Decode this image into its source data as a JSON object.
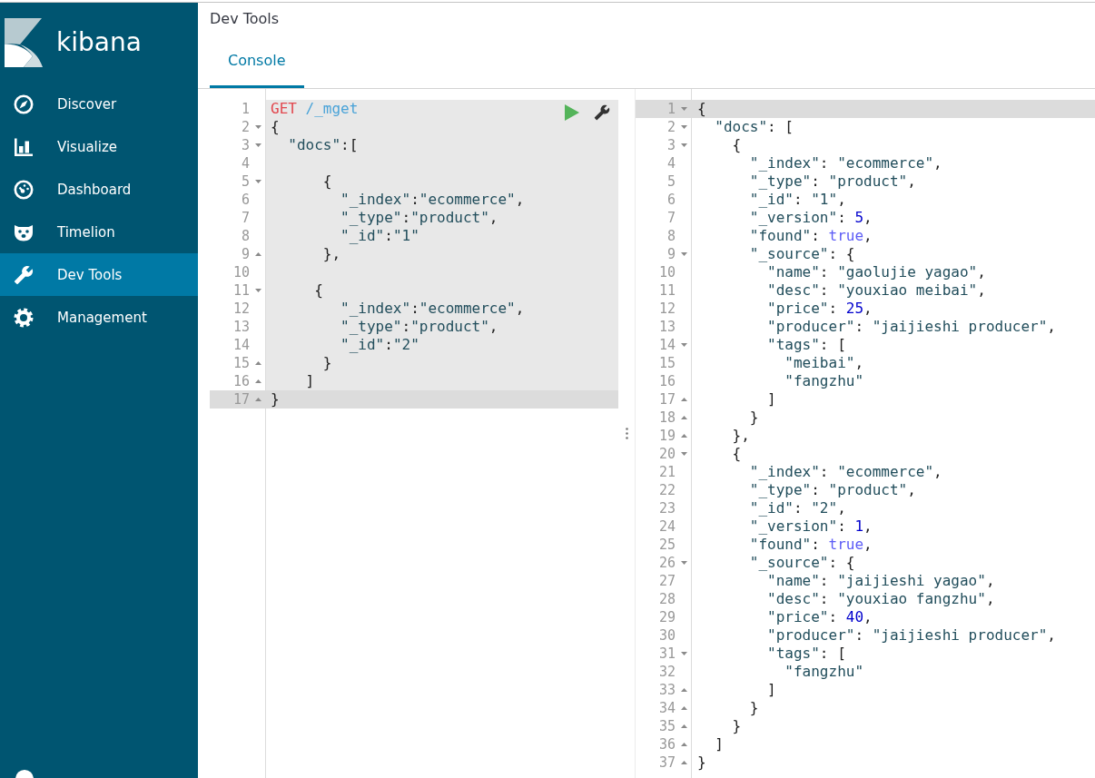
{
  "app": {
    "logo_text": "kibana"
  },
  "nav": [
    {
      "label": "Discover",
      "selected": false
    },
    {
      "label": "Visualize",
      "selected": false
    },
    {
      "label": "Dashboard",
      "selected": false
    },
    {
      "label": "Timelion",
      "selected": false
    },
    {
      "label": "Dev Tools",
      "selected": true
    },
    {
      "label": "Management",
      "selected": false
    }
  ],
  "header": {
    "title": "Dev Tools"
  },
  "tabs": [
    {
      "label": "Console",
      "selected": true
    }
  ],
  "request_editor": {
    "lines": [
      {
        "number": "1",
        "kind": "plain",
        "active": false,
        "selected": true,
        "tokens": [
          {
            "kind": "method",
            "text": "GET"
          },
          {
            "kind": "url",
            "text": " /_mget"
          }
        ]
      },
      {
        "number": "2",
        "kind": "opener",
        "active": false,
        "selected": true,
        "tokens": [
          {
            "kind": "punct",
            "text": "{"
          }
        ]
      },
      {
        "number": "3",
        "kind": "opener",
        "active": false,
        "selected": true,
        "tokens": [
          {
            "kind": "string",
            "text": "  \"docs\""
          },
          {
            "kind": "punct",
            "text": ":["
          }
        ]
      },
      {
        "number": "4",
        "kind": "plain",
        "active": false,
        "selected": true
      },
      {
        "number": "5",
        "kind": "opener",
        "active": false,
        "selected": true,
        "tokens": [
          {
            "kind": "punct",
            "text": "      {"
          }
        ]
      },
      {
        "number": "6",
        "kind": "plain",
        "active": false,
        "selected": true,
        "tokens": [
          {
            "kind": "string",
            "text": "        \"_index\""
          },
          {
            "kind": "punct",
            "text": ":"
          },
          {
            "kind": "string",
            "text": "\"ecommerce\""
          },
          {
            "kind": "punct",
            "text": ","
          }
        ]
      },
      {
        "number": "7",
        "kind": "plain",
        "active": false,
        "selected": true,
        "tokens": [
          {
            "kind": "string",
            "text": "        \"_type\""
          },
          {
            "kind": "punct",
            "text": ":"
          },
          {
            "kind": "string",
            "text": "\"product\""
          },
          {
            "kind": "punct",
            "text": ","
          }
        ]
      },
      {
        "number": "8",
        "kind": "plain",
        "active": false,
        "selected": true,
        "tokens": [
          {
            "kind": "string",
            "text": "        \"_id\""
          },
          {
            "kind": "punct",
            "text": ":"
          },
          {
            "kind": "string",
            "text": "\"1\""
          }
        ]
      },
      {
        "number": "9",
        "kind": "closer",
        "active": false,
        "selected": true,
        "tokens": [
          {
            "kind": "punct",
            "text": "      },"
          }
        ]
      },
      {
        "number": "10",
        "kind": "plain",
        "active": false,
        "selected": true
      },
      {
        "number": "11",
        "kind": "opener",
        "active": false,
        "selected": true,
        "tokens": [
          {
            "kind": "punct",
            "text": "     {"
          }
        ]
      },
      {
        "number": "12",
        "kind": "plain",
        "active": false,
        "selected": true,
        "tokens": [
          {
            "kind": "string",
            "text": "        \"_index\""
          },
          {
            "kind": "punct",
            "text": ":"
          },
          {
            "kind": "string",
            "text": "\"ecommerce\""
          },
          {
            "kind": "punct",
            "text": ","
          }
        ]
      },
      {
        "number": "13",
        "kind": "plain",
        "active": false,
        "selected": true,
        "tokens": [
          {
            "kind": "string",
            "text": "        \"_type\""
          },
          {
            "kind": "punct",
            "text": ":"
          },
          {
            "kind": "string",
            "text": "\"product\""
          },
          {
            "kind": "punct",
            "text": ","
          }
        ]
      },
      {
        "number": "14",
        "kind": "plain",
        "active": false,
        "selected": true,
        "tokens": [
          {
            "kind": "string",
            "text": "        \"_id\""
          },
          {
            "kind": "punct",
            "text": ":"
          },
          {
            "kind": "string",
            "text": "\"2\""
          }
        ]
      },
      {
        "number": "15",
        "kind": "closer",
        "active": false,
        "selected": true,
        "tokens": [
          {
            "kind": "punct",
            "text": "      }"
          }
        ]
      },
      {
        "number": "16",
        "kind": "closer",
        "active": false,
        "selected": true,
        "tokens": [
          {
            "kind": "punct",
            "text": "    ]"
          }
        ]
      },
      {
        "number": "17",
        "kind": "closer",
        "active": true,
        "selected": false,
        "tokens": [
          {
            "kind": "punct",
            "text": "}"
          }
        ]
      }
    ]
  },
  "response_editor": {
    "lines": [
      {
        "number": "1",
        "kind": "opener",
        "active": true,
        "tokens": [
          {
            "kind": "punct",
            "text": "{"
          }
        ]
      },
      {
        "number": "2",
        "kind": "opener",
        "active": false,
        "tokens": [
          {
            "kind": "string",
            "text": "  \"docs\""
          },
          {
            "kind": "punct",
            "text": ": ["
          }
        ]
      },
      {
        "number": "3",
        "kind": "opener",
        "active": false,
        "tokens": [
          {
            "kind": "punct",
            "text": "    {"
          }
        ]
      },
      {
        "number": "4",
        "kind": "plain",
        "active": false,
        "tokens": [
          {
            "kind": "string",
            "text": "      \"_index\""
          },
          {
            "kind": "punct",
            "text": ": "
          },
          {
            "kind": "string",
            "text": "\"ecommerce\""
          },
          {
            "kind": "punct",
            "text": ","
          }
        ]
      },
      {
        "number": "5",
        "kind": "plain",
        "active": false,
        "tokens": [
          {
            "kind": "string",
            "text": "      \"_type\""
          },
          {
            "kind": "punct",
            "text": ": "
          },
          {
            "kind": "string",
            "text": "\"product\""
          },
          {
            "kind": "punct",
            "text": ","
          }
        ]
      },
      {
        "number": "6",
        "kind": "plain",
        "active": false,
        "tokens": [
          {
            "kind": "string",
            "text": "      \"_id\""
          },
          {
            "kind": "punct",
            "text": ": "
          },
          {
            "kind": "string",
            "text": "\"1\""
          },
          {
            "kind": "punct",
            "text": ","
          }
        ]
      },
      {
        "number": "7",
        "kind": "plain",
        "active": false,
        "tokens": [
          {
            "kind": "string",
            "text": "      \"_version\""
          },
          {
            "kind": "punct",
            "text": ": "
          },
          {
            "kind": "number",
            "text": "5"
          },
          {
            "kind": "punct",
            "text": ","
          }
        ]
      },
      {
        "number": "8",
        "kind": "plain",
        "active": false,
        "tokens": [
          {
            "kind": "string",
            "text": "      \"found\""
          },
          {
            "kind": "punct",
            "text": ": "
          },
          {
            "kind": "boolean",
            "text": "true"
          },
          {
            "kind": "punct",
            "text": ","
          }
        ]
      },
      {
        "number": "9",
        "kind": "opener",
        "active": false,
        "tokens": [
          {
            "kind": "string",
            "text": "      \"_source\""
          },
          {
            "kind": "punct",
            "text": ": {"
          }
        ]
      },
      {
        "number": "10",
        "kind": "plain",
        "active": false,
        "tokens": [
          {
            "kind": "string",
            "text": "        \"name\""
          },
          {
            "kind": "punct",
            "text": ": "
          },
          {
            "kind": "string",
            "text": "\"gaolujie yagao\""
          },
          {
            "kind": "punct",
            "text": ","
          }
        ]
      },
      {
        "number": "11",
        "kind": "plain",
        "active": false,
        "tokens": [
          {
            "kind": "string",
            "text": "        \"desc\""
          },
          {
            "kind": "punct",
            "text": ": "
          },
          {
            "kind": "string",
            "text": "\"youxiao meibai\""
          },
          {
            "kind": "punct",
            "text": ","
          }
        ]
      },
      {
        "number": "12",
        "kind": "plain",
        "active": false,
        "tokens": [
          {
            "kind": "string",
            "text": "        \"price\""
          },
          {
            "kind": "punct",
            "text": ": "
          },
          {
            "kind": "number",
            "text": "25"
          },
          {
            "kind": "punct",
            "text": ","
          }
        ]
      },
      {
        "number": "13",
        "kind": "plain",
        "active": false,
        "tokens": [
          {
            "kind": "string",
            "text": "        \"producer\""
          },
          {
            "kind": "punct",
            "text": ": "
          },
          {
            "kind": "string",
            "text": "\"jaijieshi producer\""
          },
          {
            "kind": "punct",
            "text": ","
          }
        ]
      },
      {
        "number": "14",
        "kind": "opener",
        "active": false,
        "tokens": [
          {
            "kind": "string",
            "text": "        \"tags\""
          },
          {
            "kind": "punct",
            "text": ": ["
          }
        ]
      },
      {
        "number": "15",
        "kind": "plain",
        "active": false,
        "tokens": [
          {
            "kind": "string",
            "text": "          \"meibai\""
          },
          {
            "kind": "punct",
            "text": ","
          }
        ]
      },
      {
        "number": "16",
        "kind": "plain",
        "active": false,
        "tokens": [
          {
            "kind": "string",
            "text": "          \"fangzhu\""
          }
        ]
      },
      {
        "number": "17",
        "kind": "closer",
        "active": false,
        "tokens": [
          {
            "kind": "punct",
            "text": "        ]"
          }
        ]
      },
      {
        "number": "18",
        "kind": "closer",
        "active": false,
        "tokens": [
          {
            "kind": "punct",
            "text": "      }"
          }
        ]
      },
      {
        "number": "19",
        "kind": "closer",
        "active": false,
        "tokens": [
          {
            "kind": "punct",
            "text": "    },"
          }
        ]
      },
      {
        "number": "20",
        "kind": "opener",
        "active": false,
        "tokens": [
          {
            "kind": "punct",
            "text": "    {"
          }
        ]
      },
      {
        "number": "21",
        "kind": "plain",
        "active": false,
        "tokens": [
          {
            "kind": "string",
            "text": "      \"_index\""
          },
          {
            "kind": "punct",
            "text": ": "
          },
          {
            "kind": "string",
            "text": "\"ecommerce\""
          },
          {
            "kind": "punct",
            "text": ","
          }
        ]
      },
      {
        "number": "22",
        "kind": "plain",
        "active": false,
        "tokens": [
          {
            "kind": "string",
            "text": "      \"_type\""
          },
          {
            "kind": "punct",
            "text": ": "
          },
          {
            "kind": "string",
            "text": "\"product\""
          },
          {
            "kind": "punct",
            "text": ","
          }
        ]
      },
      {
        "number": "23",
        "kind": "plain",
        "active": false,
        "tokens": [
          {
            "kind": "string",
            "text": "      \"_id\""
          },
          {
            "kind": "punct",
            "text": ": "
          },
          {
            "kind": "string",
            "text": "\"2\""
          },
          {
            "kind": "punct",
            "text": ","
          }
        ]
      },
      {
        "number": "24",
        "kind": "plain",
        "active": false,
        "tokens": [
          {
            "kind": "string",
            "text": "      \"_version\""
          },
          {
            "kind": "punct",
            "text": ": "
          },
          {
            "kind": "number",
            "text": "1"
          },
          {
            "kind": "punct",
            "text": ","
          }
        ]
      },
      {
        "number": "25",
        "kind": "plain",
        "active": false,
        "tokens": [
          {
            "kind": "string",
            "text": "      \"found\""
          },
          {
            "kind": "punct",
            "text": ": "
          },
          {
            "kind": "boolean",
            "text": "true"
          },
          {
            "kind": "punct",
            "text": ","
          }
        ]
      },
      {
        "number": "26",
        "kind": "opener",
        "active": false,
        "tokens": [
          {
            "kind": "string",
            "text": "      \"_source\""
          },
          {
            "kind": "punct",
            "text": ": {"
          }
        ]
      },
      {
        "number": "27",
        "kind": "plain",
        "active": false,
        "tokens": [
          {
            "kind": "string",
            "text": "        \"name\""
          },
          {
            "kind": "punct",
            "text": ": "
          },
          {
            "kind": "string",
            "text": "\"jaijieshi yagao\""
          },
          {
            "kind": "punct",
            "text": ","
          }
        ]
      },
      {
        "number": "28",
        "kind": "plain",
        "active": false,
        "tokens": [
          {
            "kind": "string",
            "text": "        \"desc\""
          },
          {
            "kind": "punct",
            "text": ": "
          },
          {
            "kind": "string",
            "text": "\"youxiao fangzhu\""
          },
          {
            "kind": "punct",
            "text": ","
          }
        ]
      },
      {
        "number": "29",
        "kind": "plain",
        "active": false,
        "tokens": [
          {
            "kind": "string",
            "text": "        \"price\""
          },
          {
            "kind": "punct",
            "text": ": "
          },
          {
            "kind": "number",
            "text": "40"
          },
          {
            "kind": "punct",
            "text": ","
          }
        ]
      },
      {
        "number": "30",
        "kind": "plain",
        "active": false,
        "tokens": [
          {
            "kind": "string",
            "text": "        \"producer\""
          },
          {
            "kind": "punct",
            "text": ": "
          },
          {
            "kind": "string",
            "text": "\"jaijieshi producer\""
          },
          {
            "kind": "punct",
            "text": ","
          }
        ]
      },
      {
        "number": "31",
        "kind": "opener",
        "active": false,
        "tokens": [
          {
            "kind": "string",
            "text": "        \"tags\""
          },
          {
            "kind": "punct",
            "text": ": ["
          }
        ]
      },
      {
        "number": "32",
        "kind": "plain",
        "active": false,
        "tokens": [
          {
            "kind": "string",
            "text": "          \"fangzhu\""
          }
        ]
      },
      {
        "number": "33",
        "kind": "closer",
        "active": false,
        "tokens": [
          {
            "kind": "punct",
            "text": "        ]"
          }
        ]
      },
      {
        "number": "34",
        "kind": "closer",
        "active": false,
        "tokens": [
          {
            "kind": "punct",
            "text": "      }"
          }
        ]
      },
      {
        "number": "35",
        "kind": "closer",
        "active": false,
        "tokens": [
          {
            "kind": "punct",
            "text": "    }"
          }
        ]
      },
      {
        "number": "36",
        "kind": "closer",
        "active": false,
        "tokens": [
          {
            "kind": "punct",
            "text": "  ]"
          }
        ]
      },
      {
        "number": "37",
        "kind": "closer",
        "active": false,
        "tokens": [
          {
            "kind": "punct",
            "text": "}"
          }
        ]
      }
    ]
  }
}
